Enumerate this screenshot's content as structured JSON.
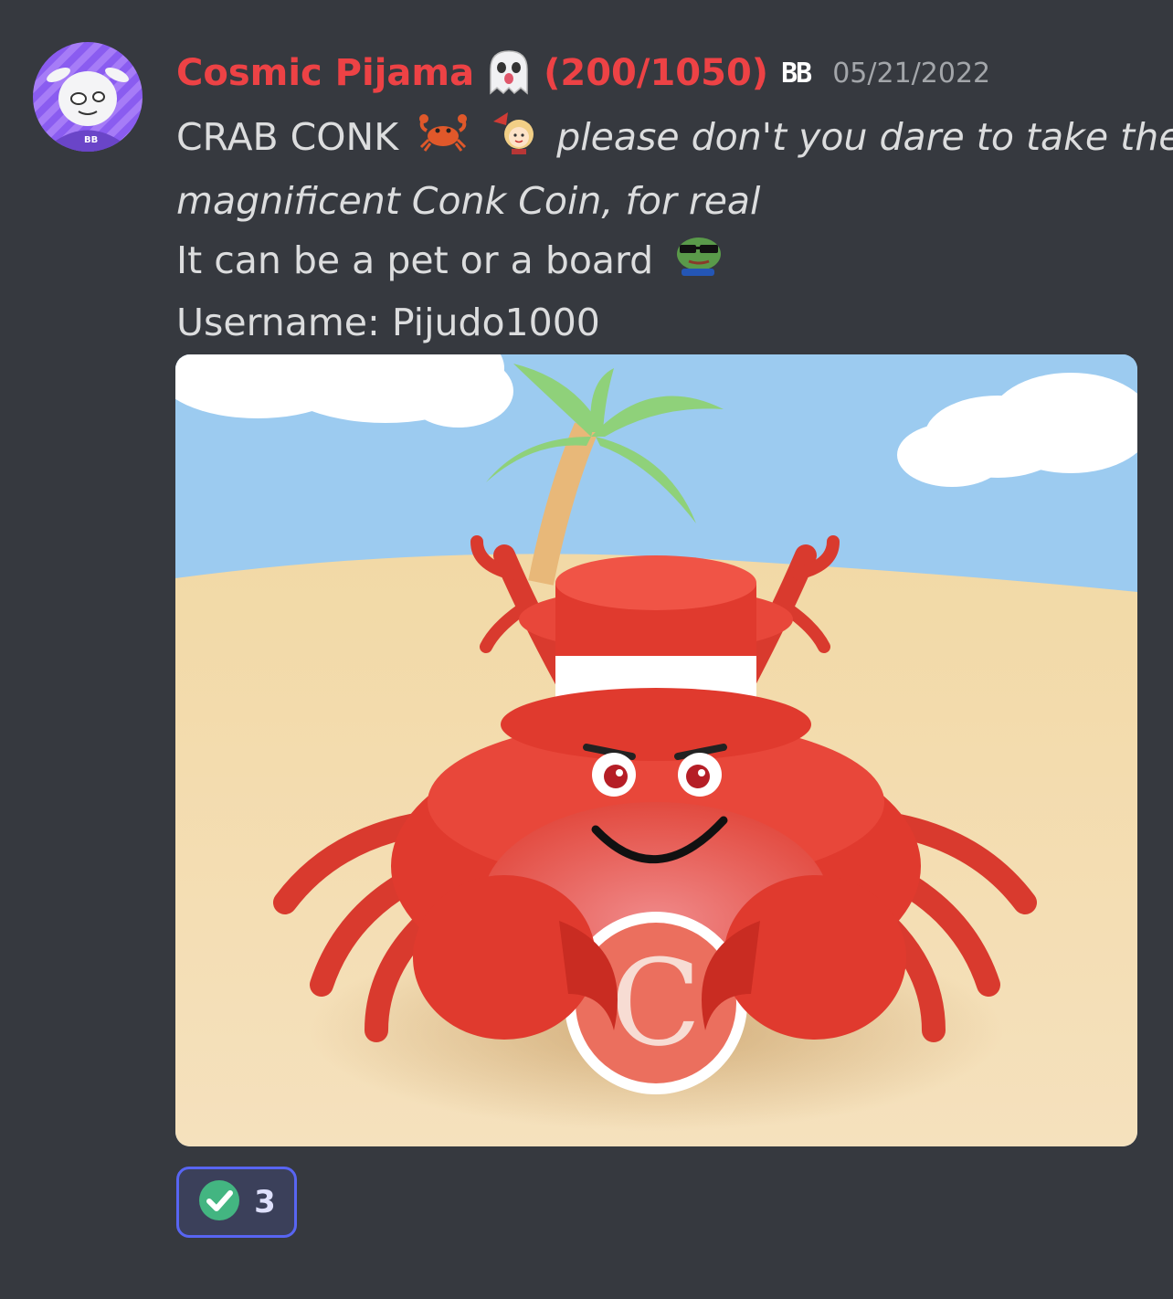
{
  "message": {
    "author": {
      "name": "Cosmic Pijama",
      "rank": "(200/1050)",
      "badge": "BB",
      "avatar_icon": "cow-mascot-avatar"
    },
    "timestamp": "05/21/2022",
    "lines": [
      {
        "text": "CRAB CONK",
        "italic_text": "please don't you dare to take the"
      },
      {
        "italic_text": "magnificent Conk Coin, for real"
      },
      {
        "text": "It can be a pet or a board"
      },
      {
        "text": "Username: Pijudo1000"
      }
    ],
    "emojis": [
      "ghost-emoji",
      "crab-emoji",
      "cheering-girl-emoji",
      "cool-pepe-emoji"
    ],
    "attachment": {
      "description_icon": "crab-conk-coin-illustration",
      "coin_letter": "C"
    },
    "reaction": {
      "icon": "white-check-mark-icon",
      "count": "3"
    }
  },
  "colors": {
    "background": "#36393f",
    "username": "#ed4245",
    "reaction_border": "#5865f2",
    "timestamp": "#a3a6aa"
  }
}
